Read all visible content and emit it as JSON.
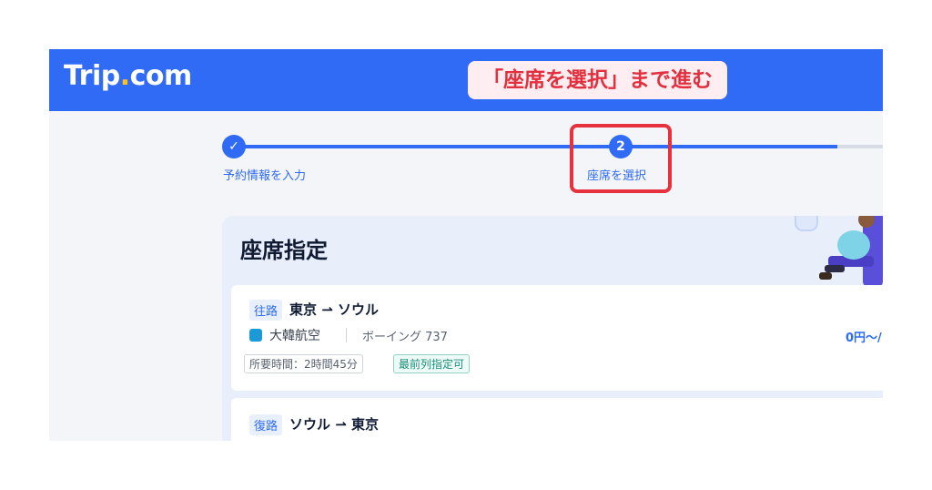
{
  "header": {
    "logo_main": "Trip",
    "logo_dot": ".",
    "logo_tld": "com",
    "callout": "「座席を選択」まで進む"
  },
  "steps": [
    {
      "number": "✓",
      "label": "予約情報を入力",
      "status": "completed"
    },
    {
      "number": "2",
      "label": "座席を選択",
      "status": "current"
    }
  ],
  "progress": {
    "fill_fraction": 0.93
  },
  "seat_selection": {
    "title": "座席指定",
    "flights": [
      {
        "tag": "往路",
        "route": "東京 ⇀ ソウル",
        "airline": "大韓航空",
        "aircraft": "ボーイング 737",
        "price": "0円〜/",
        "duration": "所要時間：2時間45分",
        "feature": "最前列指定可"
      },
      {
        "tag": "復路",
        "route": "ソウル ⇀ 東京"
      }
    ]
  },
  "colors": {
    "brand": "#2f6bf5",
    "callout_text": "#e2303f",
    "highlight": "#e8313f"
  }
}
